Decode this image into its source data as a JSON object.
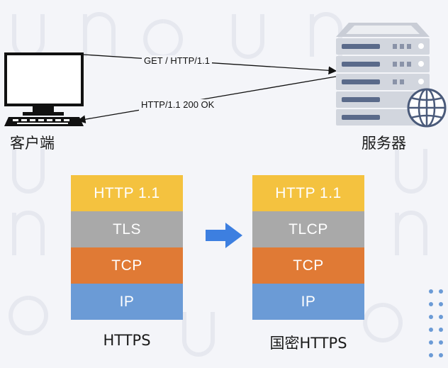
{
  "client": {
    "label": "客户端"
  },
  "server": {
    "label": "服务器"
  },
  "request": {
    "text": "GET / HTTP/1.1"
  },
  "response": {
    "text": "HTTP/1.1 200 OK"
  },
  "stacks": {
    "left": {
      "caption": "HTTPS",
      "layers": [
        "HTTP 1.1",
        "TLS",
        "TCP",
        "IP"
      ]
    },
    "right": {
      "caption": "国密HTTPS",
      "layers": [
        "HTTP 1.1",
        "TLCP",
        "TCP",
        "IP"
      ]
    }
  },
  "colors": {
    "http": "#f4c23f",
    "tls": "#a9a9a9",
    "tcp": "#e07a35",
    "ip": "#6b9bd6",
    "arrow": "#3d7fe0"
  }
}
